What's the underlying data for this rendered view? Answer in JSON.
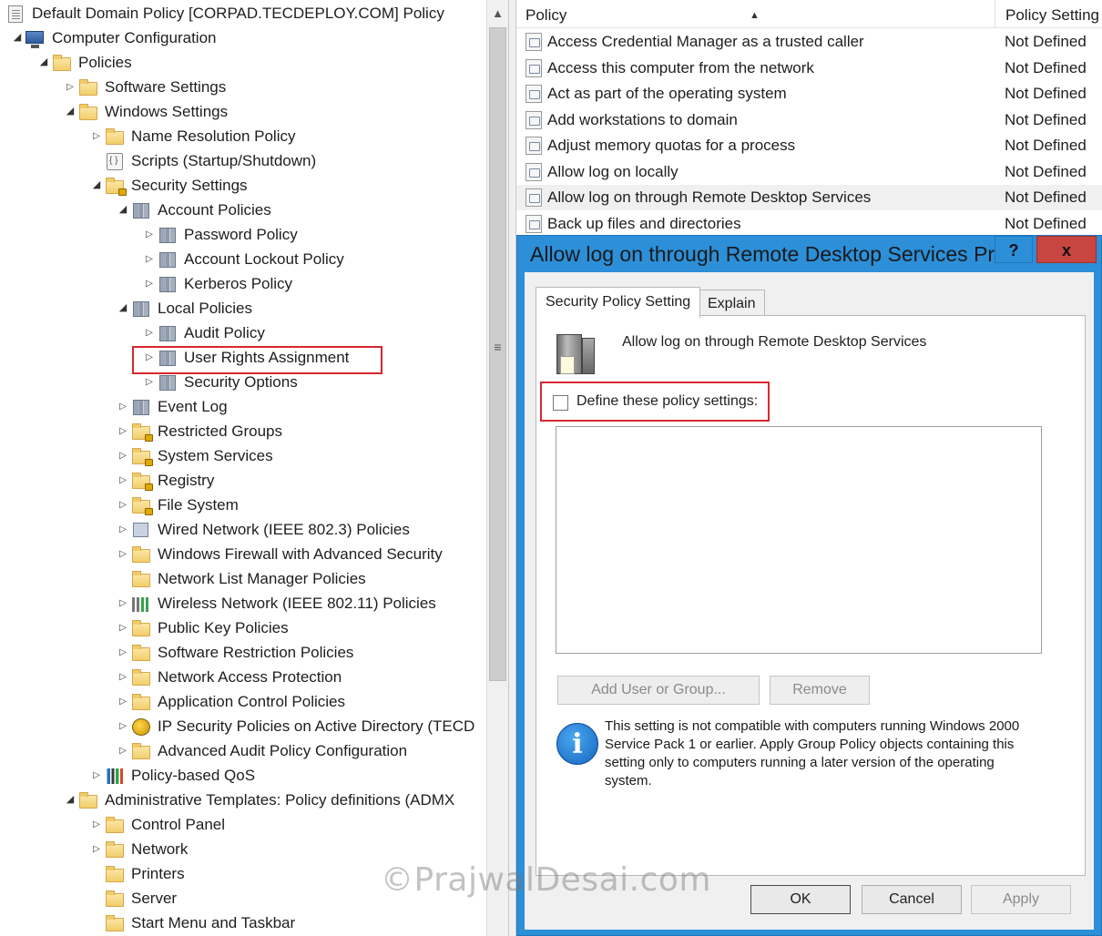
{
  "tree": {
    "root": "Default Domain Policy [CORPAD.TECDEPLOY.COM] Policy",
    "items": [
      {
        "label": "Computer Configuration"
      },
      {
        "label": "Policies"
      },
      {
        "label": "Software Settings"
      },
      {
        "label": "Windows Settings"
      },
      {
        "label": "Name Resolution Policy"
      },
      {
        "label": "Scripts (Startup/Shutdown)"
      },
      {
        "label": "Security Settings"
      },
      {
        "label": "Account Policies"
      },
      {
        "label": "Password Policy"
      },
      {
        "label": "Account Lockout Policy"
      },
      {
        "label": "Kerberos Policy"
      },
      {
        "label": "Local Policies"
      },
      {
        "label": "Audit Policy"
      },
      {
        "label": "User Rights Assignment"
      },
      {
        "label": "Security Options"
      },
      {
        "label": "Event Log"
      },
      {
        "label": "Restricted Groups"
      },
      {
        "label": "System Services"
      },
      {
        "label": "Registry"
      },
      {
        "label": "File System"
      },
      {
        "label": "Wired Network (IEEE 802.3) Policies"
      },
      {
        "label": "Windows Firewall with Advanced Security"
      },
      {
        "label": "Network List Manager Policies"
      },
      {
        "label": "Wireless Network (IEEE 802.11) Policies"
      },
      {
        "label": "Public Key Policies"
      },
      {
        "label": "Software Restriction Policies"
      },
      {
        "label": "Network Access Protection"
      },
      {
        "label": "Application Control Policies"
      },
      {
        "label": "IP Security Policies on Active Directory (TECD"
      },
      {
        "label": "Advanced Audit Policy Configuration"
      },
      {
        "label": "Policy-based QoS"
      },
      {
        "label": "Administrative Templates: Policy definitions (ADMX"
      },
      {
        "label": "Control Panel"
      },
      {
        "label": "Network"
      },
      {
        "label": "Printers"
      },
      {
        "label": "Server"
      },
      {
        "label": "Start Menu and Taskbar"
      }
    ]
  },
  "list": {
    "col_policy": "Policy",
    "col_setting": "Policy Setting",
    "rows": [
      {
        "name": "Access Credential Manager as a trusted caller",
        "setting": "Not Defined"
      },
      {
        "name": "Access this computer from the network",
        "setting": "Not Defined"
      },
      {
        "name": "Act as part of the operating system",
        "setting": "Not Defined"
      },
      {
        "name": "Add workstations to domain",
        "setting": "Not Defined"
      },
      {
        "name": "Adjust memory quotas for a process",
        "setting": "Not Defined"
      },
      {
        "name": "Allow log on locally",
        "setting": "Not Defined"
      },
      {
        "name": "Allow log on through Remote Desktop Services",
        "setting": "Not Defined"
      },
      {
        "name": "Back up files and directories",
        "setting": "Not Defined"
      }
    ]
  },
  "dialog": {
    "title": "Allow log on through Remote Desktop Services Pr...",
    "help_label": "?",
    "close_label": "x",
    "tab_security": "Security Policy Setting",
    "tab_explain": "Explain",
    "policy_heading": "Allow log on through Remote Desktop Services",
    "define_label": "Define these policy settings:",
    "define_checked": false,
    "add_button": "Add User or Group...",
    "remove_button": "Remove",
    "info_icon_glyph": "i",
    "info_text": "This setting is not compatible with computers running Windows 2000 Service Pack 1 or earlier.  Apply Group Policy objects containing this setting only to computers running a later version of the operating system.",
    "ok_button": "OK",
    "cancel_button": "Cancel",
    "apply_button": "Apply"
  },
  "watermark": "©PrajwalDesai.com",
  "colors": {
    "dialog_frame": "#2c8fd8",
    "close_button": "#c7463f",
    "highlight": "#d9272e"
  }
}
